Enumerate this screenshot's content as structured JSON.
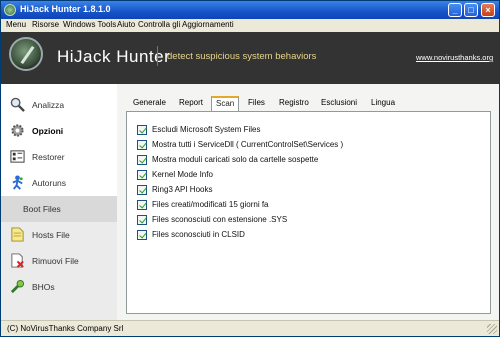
{
  "window": {
    "title": "HiJack Hunter 1.8.1.0"
  },
  "menu": [
    "Menu",
    "Risorse",
    "Windows Tools",
    "Aiuto",
    "Controlla gli Aggiornamenti"
  ],
  "header": {
    "brand": "HiJack Hunter",
    "tagline": "detect suspicious system behaviors",
    "link": "www.novirusthanks.org"
  },
  "sidebar": {
    "items": [
      {
        "label": "Analizza",
        "icon": "magnifier-icon"
      },
      {
        "label": "Opzioni",
        "icon": "gear-icon"
      },
      {
        "label": "Restorer",
        "icon": "restore-icon"
      },
      {
        "label": "Autoruns",
        "icon": "autoruns-icon"
      },
      {
        "label": "Boot Files",
        "icon": "boot-files-icon"
      },
      {
        "label": "Hosts File",
        "icon": "hosts-file-icon"
      },
      {
        "label": "Rimuovi File",
        "icon": "delete-file-icon"
      },
      {
        "label": "BHOs",
        "icon": "bho-icon"
      }
    ]
  },
  "tabs": [
    "Generale",
    "Report",
    "Scan",
    "Files",
    "Registro",
    "Esclusioni",
    "Lingua"
  ],
  "active_tab": "Scan",
  "options": [
    {
      "label": "Escludi Microsoft System Files",
      "checked": true
    },
    {
      "label": "Mostra tutti i ServiceDll ( CurrentControlSet\\Services )",
      "checked": true
    },
    {
      "label": "Mostra moduli caricati solo da cartelle sospette",
      "checked": true
    },
    {
      "label": "Kernel Mode Info",
      "checked": true
    },
    {
      "label": "Ring3 API Hooks",
      "checked": true
    },
    {
      "label": "Files creati/modificati 15 giorni fa",
      "checked": true
    },
    {
      "label": "Files sconosciuti con estensione .SYS",
      "checked": true
    },
    {
      "label": "Files sconosciuti in CLSID",
      "checked": true
    }
  ],
  "status": "(C) NoVirusThanks Company Srl"
}
